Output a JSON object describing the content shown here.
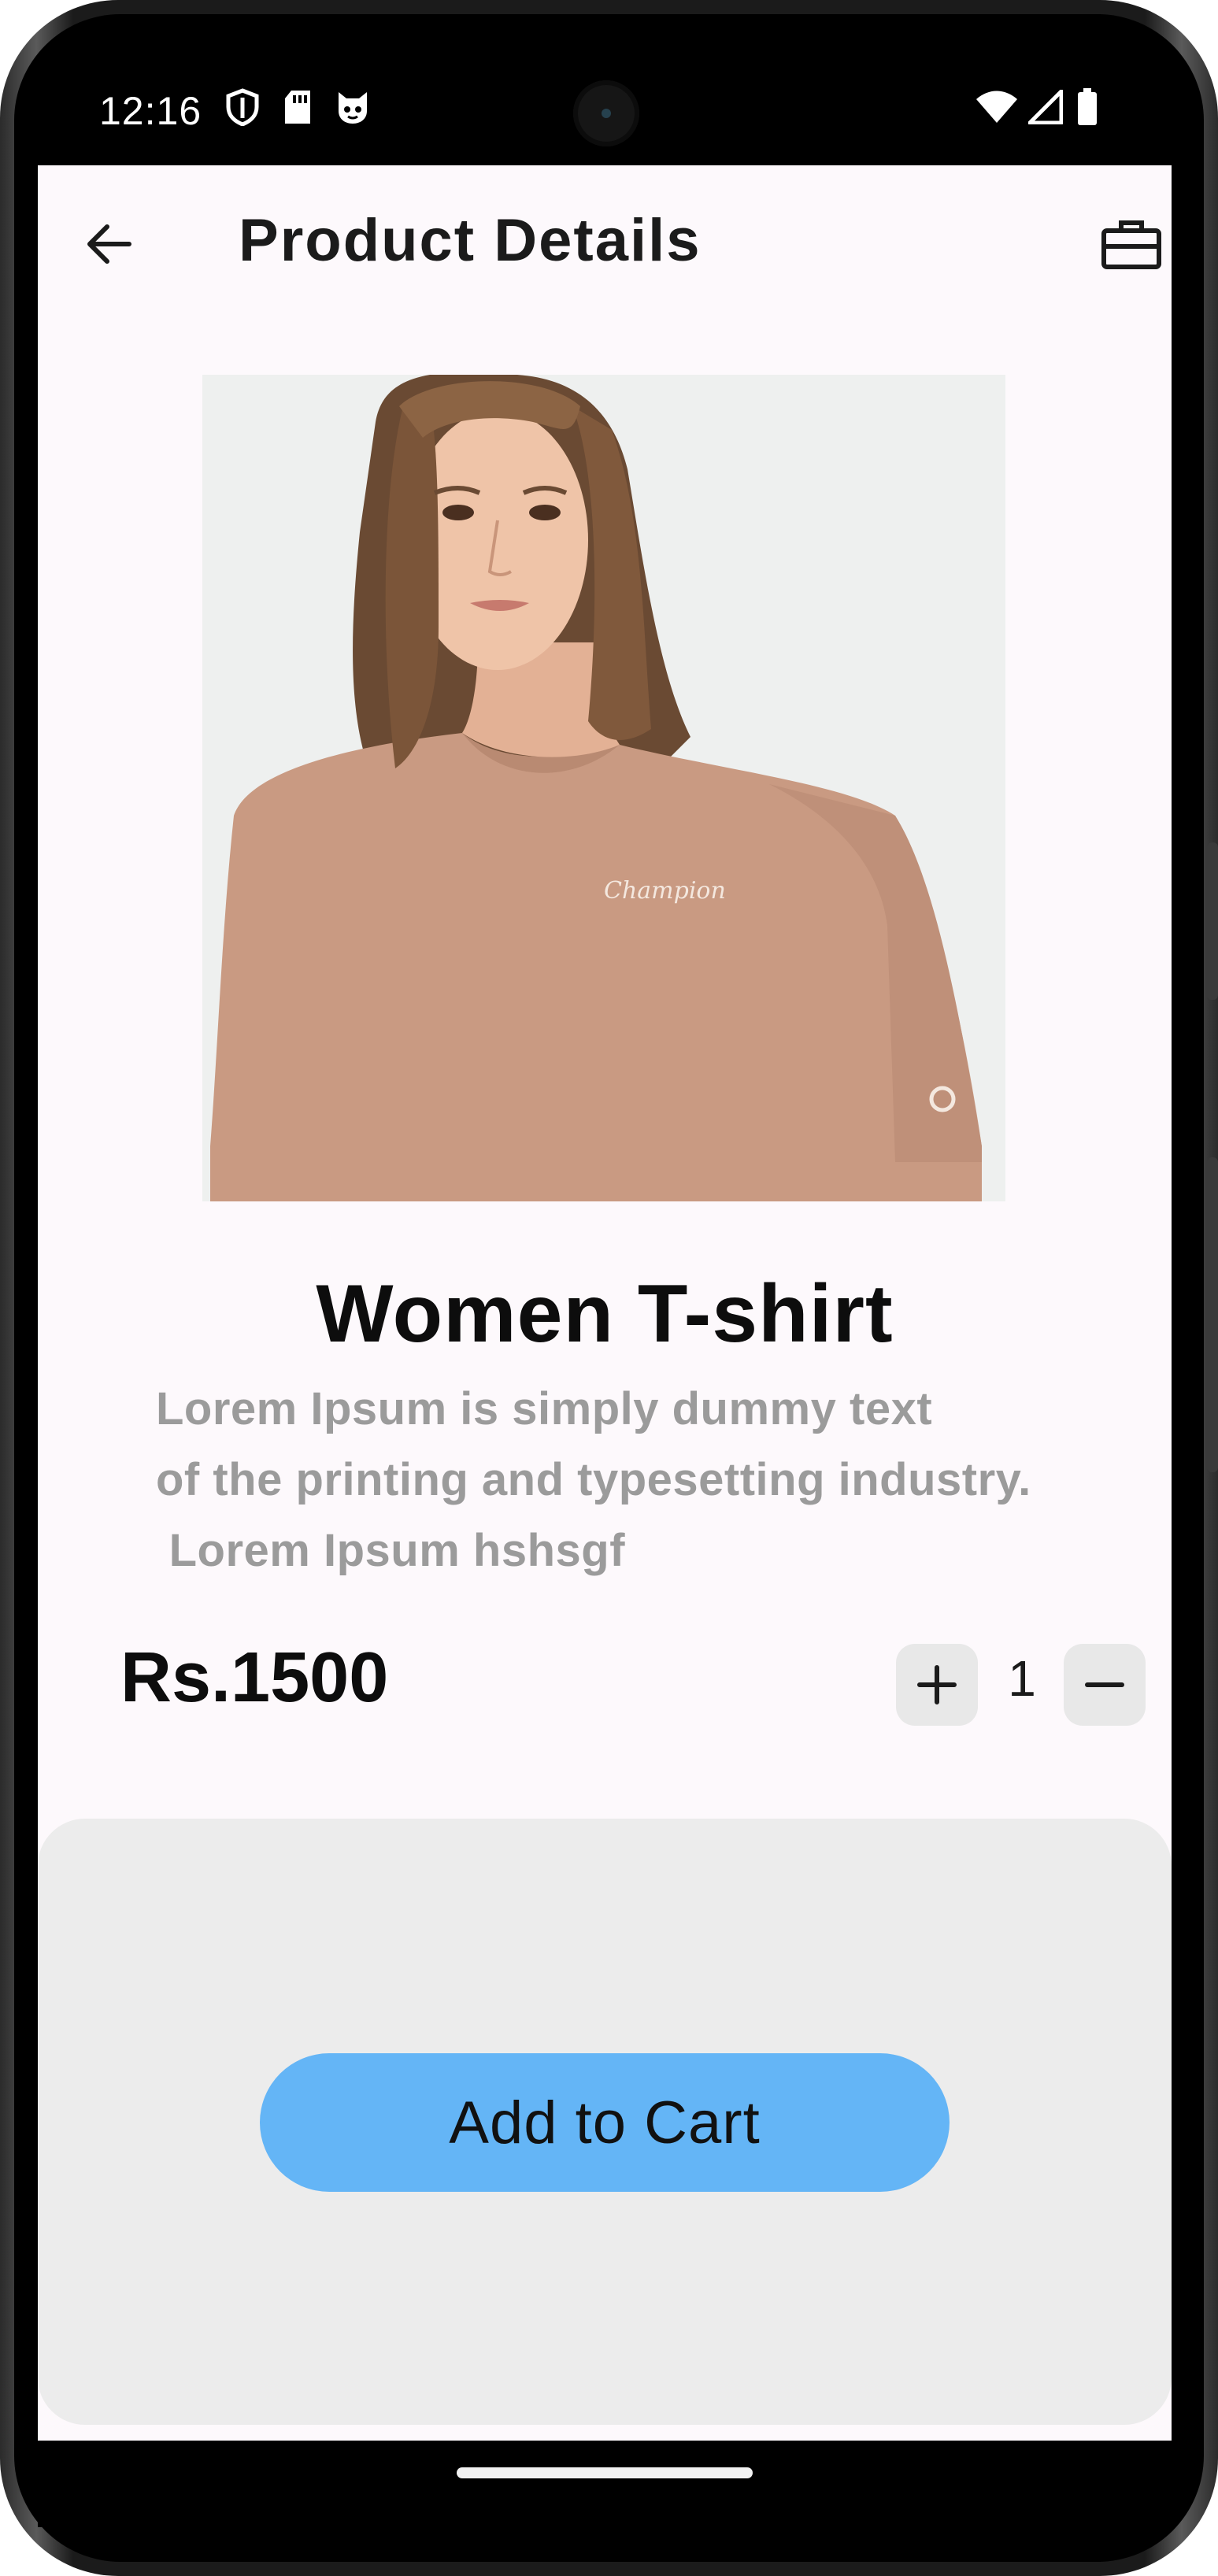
{
  "status_bar": {
    "time": "12:16",
    "left_icons": [
      "shield-icon",
      "sd-card-icon",
      "cat-face-icon"
    ],
    "right_icons": [
      "wifi-icon",
      "cell-signal-icon",
      "battery-icon"
    ]
  },
  "app_bar": {
    "title": "Product Details",
    "back_icon": "arrow-left-icon",
    "action_icon": "briefcase-icon"
  },
  "product": {
    "image_description": "woman-in-tan-tshirt",
    "image_brand_mark": "Champion",
    "name": "Women T-shirt",
    "description_lines": [
      "Lorem Ipsum is simply dummy text",
      "of the printing and typesetting industry.",
      " Lorem Ipsum hshsgf"
    ],
    "price": "Rs.1500",
    "quantity": "1"
  },
  "actions": {
    "add_to_cart": "Add to Cart",
    "accent_color": "#64b5f6"
  }
}
